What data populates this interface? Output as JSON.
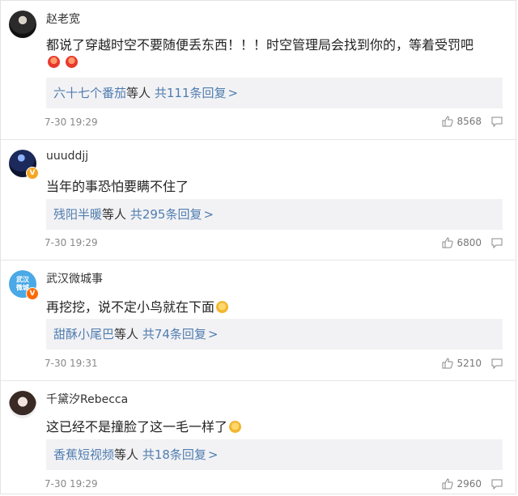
{
  "comments": [
    {
      "avatar_icon": "dark-portrait-avatar",
      "username": "赵老宽",
      "text": "都说了穿越时空不要随便丢东西！！！时空管理局会找到你的，等着受罚吧",
      "emoji_after_text_line2": [
        "angry-face-emoji",
        "angry-face-emoji"
      ],
      "reply_name": "六十七个番茄",
      "reply_mid": "等人",
      "reply_count": "共111条回复",
      "time": "7-30 19:29",
      "likes": "8568",
      "badge": ""
    },
    {
      "avatar_icon": "space-avatar",
      "username": "uuuddjj",
      "text": "当年的事恐怕要瞒不住了",
      "reply_name": "残阳半暖",
      "reply_mid": "等人",
      "reply_count": "共295条回复",
      "time": "7-30 19:29",
      "likes": "6800",
      "badge": "V"
    },
    {
      "avatar_icon": "wuhan-logo-avatar",
      "avatar_text_line1": "武汉",
      "avatar_text_line2": "微城",
      "username": "武汉微城事",
      "text": "再挖挖，说不定小鸟就在下面",
      "reply_name": "甜酥小尾巴",
      "reply_mid": "等人",
      "reply_count": "共74条回复",
      "time": "7-30 19:31",
      "likes": "5210",
      "badge": "V"
    },
    {
      "avatar_icon": "girl-portrait-avatar",
      "username": "千黛汐Rebecca",
      "text": "这已经不是撞脸了这一毛一样了",
      "reply_name": "香蕉短视频",
      "reply_mid": "等人",
      "reply_count": "共18条回复",
      "time": "7-30 19:29",
      "likes": "2960",
      "badge": ""
    }
  ],
  "colors": {
    "link": "#507daf",
    "reply_bg": "#f2f2f5",
    "verified_yellow": "#f5a623",
    "verified_orange": "#ff6a00"
  }
}
